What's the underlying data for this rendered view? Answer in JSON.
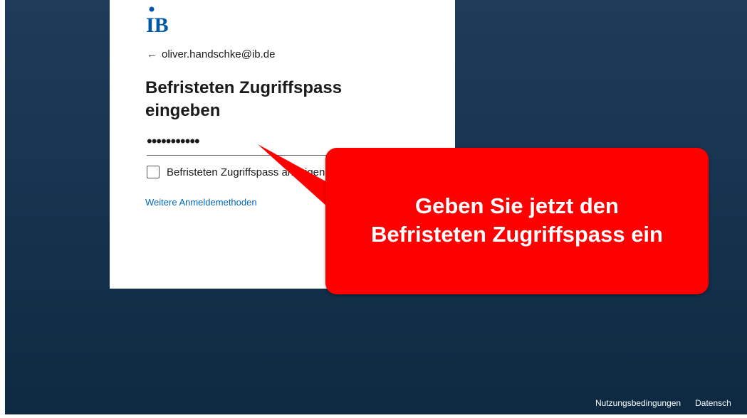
{
  "brand": {
    "logo_text": "IB",
    "color": "#0057a3"
  },
  "account": {
    "back_icon": "arrow-left-icon",
    "email": "oliver.handschke@ib.de"
  },
  "form": {
    "title_line1": "Befristeten Zugriffspass",
    "title_line2": "eingeben",
    "password_value": "•••••••••••",
    "checkbox_label": "Befristeten Zugriffspass anzeigen",
    "checkbox_checked": false,
    "more_methods_link": "Weitere Anmeldemethoden"
  },
  "callout": {
    "line1": "Geben Sie jetzt den",
    "line2": "Befristeten Zugriffspass ein",
    "color": "#ff0000"
  },
  "footer": {
    "terms": "Nutzungsbedingungen",
    "privacy": "Datensch"
  },
  "colors": {
    "background_top": "#1e3c5a",
    "background_bottom": "#0d2a42",
    "link": "#0067b8"
  }
}
